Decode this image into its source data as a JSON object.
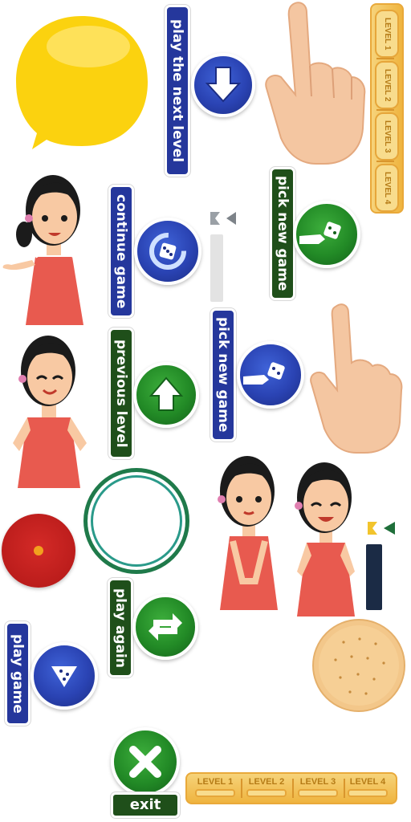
{
  "sprites": {
    "play_next_level": {
      "label": "play the next level",
      "icon": "down-arrow-icon",
      "color": "#25379c"
    },
    "continue_game": {
      "label": "continue game",
      "icon": "dice-refresh-icon",
      "color": "#25379c"
    },
    "pick_new_game_green": {
      "label": "pick new game",
      "icon": "dice-hand-icon",
      "color": "#1f4f1a"
    },
    "pick_new_game_blue": {
      "label": "pick new game",
      "icon": "dice-hand-icon",
      "color": "#25379c"
    },
    "previous_level": {
      "label": "previous level",
      "icon": "up-arrow-icon",
      "color": "#1f4f1a"
    },
    "play_again": {
      "label": "play again",
      "icon": "refresh-icon",
      "color": "#1f4f1a"
    },
    "play_game": {
      "label": "play game",
      "icon": "dice-play-icon",
      "color": "#25379c"
    },
    "exit": {
      "label": "exit",
      "icon": "close-icon",
      "color": "#1f4f1a"
    }
  },
  "levels_vertical": [
    "LEVEL 1",
    "LEVEL 2",
    "LEVEL 3",
    "LEVEL 4"
  ],
  "levels_horizontal": [
    "LEVEL 1",
    "LEVEL 2",
    "LEVEL 3",
    "LEVEL 4"
  ],
  "colors": {
    "speech_bubble": "#fbd20f",
    "red_button": "#c9201f",
    "ring": "#1f7a4a",
    "cookie": "#f3c78a",
    "skin": "#f8c9a3",
    "dress": "#e85a4f",
    "hair": "#1b1b1b",
    "level_bar": "#efb43f"
  }
}
